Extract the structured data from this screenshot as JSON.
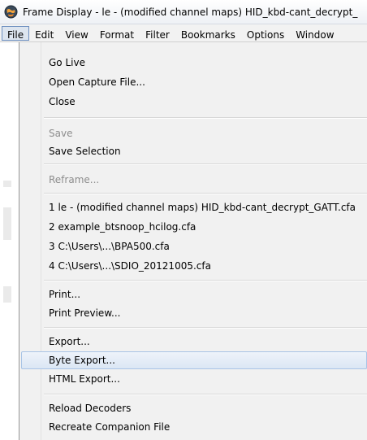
{
  "window": {
    "title": "Frame Display - le - (modified channel maps) HID_kbd-cant_decrypt_",
    "icon": "app-globe-icon"
  },
  "menubar": {
    "items": [
      "File",
      "Edit",
      "View",
      "Format",
      "Filter",
      "Bookmarks",
      "Options",
      "Window"
    ],
    "active": "File"
  },
  "file_menu": {
    "go_live": "Go Live",
    "open_capture": "Open Capture File...",
    "close": "Close",
    "save": "Save",
    "save_selection": "Save Selection",
    "reframe": "Reframe...",
    "recent": [
      "1 le - (modified channel maps) HID_kbd-cant_decrypt_GATT.cfa",
      "2 example_btsnoop_hcilog.cfa",
      "3 C:\\Users\\...\\BPA500.cfa",
      "4 C:\\Users\\...\\SDIO_20121005.cfa"
    ],
    "print": "Print...",
    "print_preview": "Print Preview...",
    "export": "Export...",
    "byte_export": "Byte Export...",
    "html_export": "HTML Export...",
    "reload_decoders": "Reload Decoders",
    "recreate_companion": "Recreate Companion File"
  }
}
